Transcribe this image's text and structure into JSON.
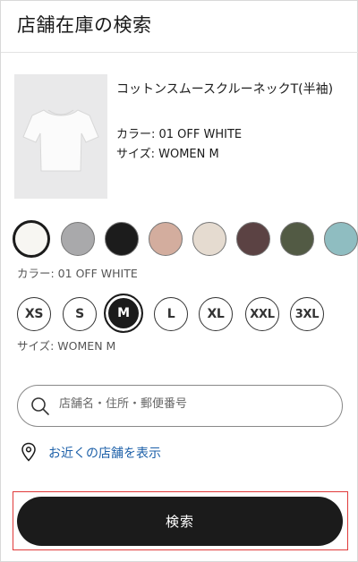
{
  "header": {
    "title": "店舗在庫の検索"
  },
  "product": {
    "name": "コットンスムースクルーネックT(半袖)",
    "color": "カラー: 01 OFF WHITE",
    "size": "サイズ: WOMEN M",
    "image_icon": "tshirt-image"
  },
  "colors": {
    "swatches": [
      "#f7f6f2",
      "#a9a9ab",
      "#1c1c1c",
      "#d3ad9e",
      "#e5dbd0",
      "#5b4243",
      "#525a44",
      "#8fbdc1"
    ],
    "selected_index": 0,
    "label": "カラー: 01 OFF WHITE"
  },
  "sizes": {
    "options": [
      "XS",
      "S",
      "M",
      "L",
      "XL",
      "XXL",
      "3XL"
    ],
    "selected": "M",
    "label": "サイズ: WOMEN M"
  },
  "search": {
    "placeholder": "店舗名・住所・郵便番号",
    "icon": "search-icon"
  },
  "nearby": {
    "label": "お近くの店舗を表示",
    "icon": "location-pin-icon",
    "color": "#1b5fa8"
  },
  "action": {
    "search_button": "検索",
    "highlight_color": "#e03a3a"
  }
}
